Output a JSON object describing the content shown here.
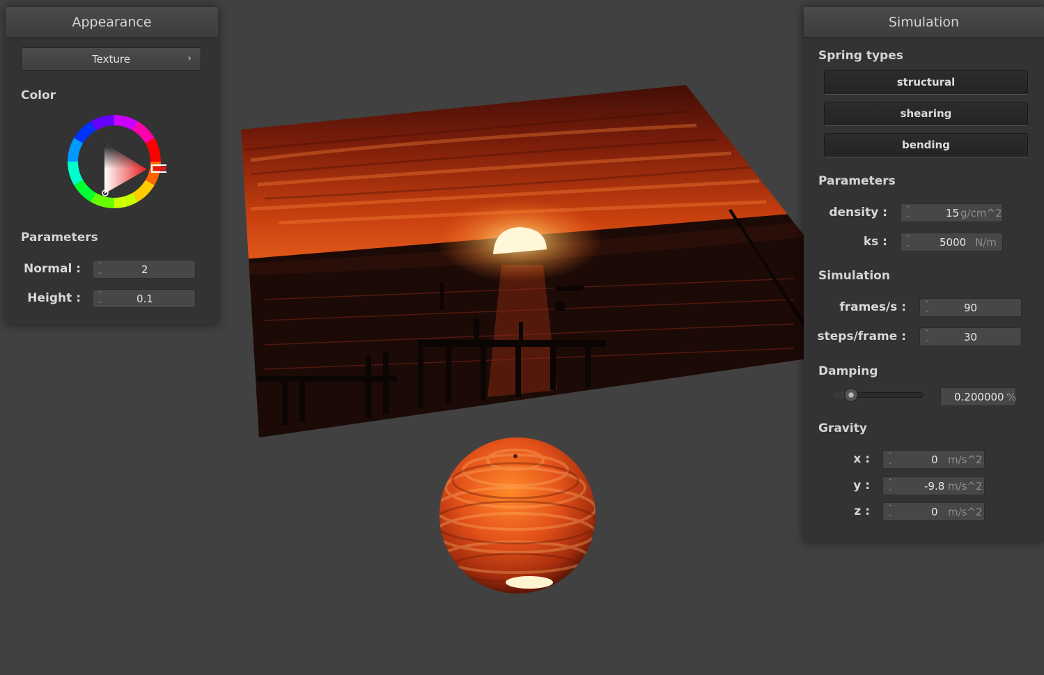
{
  "appearance": {
    "title": "Appearance",
    "texture_label": "Texture",
    "color_label": "Color",
    "parameters_label": "Parameters",
    "normal": {
      "label": "Normal :",
      "value": "2"
    },
    "height": {
      "label": "Height :",
      "value": "0.1"
    },
    "selected_color": "#e31a1a"
  },
  "simulation": {
    "title": "Simulation",
    "spring_types_label": "Spring types",
    "spring_types": [
      "structural",
      "shearing",
      "bending"
    ],
    "parameters_label": "Parameters",
    "density": {
      "label": "density :",
      "value": "15",
      "unit": "g/cm^2"
    },
    "ks": {
      "label": "ks :",
      "value": "5000",
      "unit": "N/m"
    },
    "simulation_label": "Simulation",
    "frames": {
      "label": "frames/s :",
      "value": "90"
    },
    "steps": {
      "label": "steps/frame :",
      "value": "30"
    },
    "damping_label": "Damping",
    "damping": {
      "value": "0.200000",
      "unit": "%",
      "slider_fraction": 0.2
    },
    "gravity_label": "Gravity",
    "gravity": {
      "x": {
        "label": "x :",
        "value": "0",
        "unit": "m/s^2"
      },
      "y": {
        "label": "y :",
        "value": "-9.8",
        "unit": "m/s^2"
      },
      "z": {
        "label": "z :",
        "value": "0",
        "unit": "m/s^2"
      }
    }
  },
  "icons": {
    "spin_arrows": "up-down-spinner-icon",
    "chevron": "chevron-right-icon",
    "color_wheel": "color-wheel-icon"
  },
  "colors": {
    "background": "#414141",
    "panel": "#333333",
    "sunset_orange": "#e0441a"
  }
}
